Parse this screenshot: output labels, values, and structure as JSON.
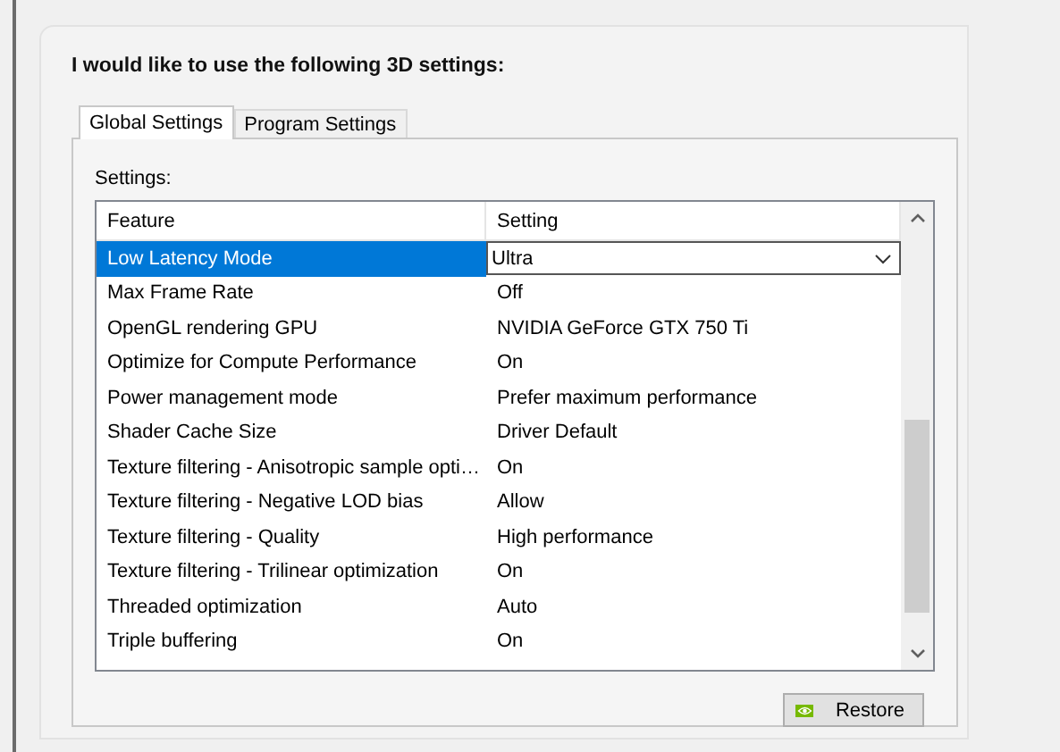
{
  "heading": "I would like to use the following 3D settings:",
  "tabs": [
    {
      "label": "Global Settings",
      "selected": true
    },
    {
      "label": "Program Settings",
      "selected": false
    }
  ],
  "settings_label": "Settings:",
  "table": {
    "columns": [
      "Feature",
      "Setting"
    ],
    "rows": [
      {
        "feature": "Low Latency Mode",
        "setting": "Ultra",
        "selected": true
      },
      {
        "feature": "Max Frame Rate",
        "setting": "Off",
        "selected": false
      },
      {
        "feature": "OpenGL rendering GPU",
        "setting": "NVIDIA GeForce GTX 750 Ti",
        "selected": false
      },
      {
        "feature": "Optimize for Compute Performance",
        "setting": "On",
        "selected": false
      },
      {
        "feature": "Power management mode",
        "setting": "Prefer maximum performance",
        "selected": false
      },
      {
        "feature": "Shader Cache Size",
        "setting": "Driver Default",
        "selected": false
      },
      {
        "feature": "Texture filtering - Anisotropic sample opti…",
        "setting": "On",
        "selected": false
      },
      {
        "feature": "Texture filtering - Negative LOD bias",
        "setting": "Allow",
        "selected": false
      },
      {
        "feature": "Texture filtering - Quality",
        "setting": "High performance",
        "selected": false
      },
      {
        "feature": "Texture filtering - Trilinear optimization",
        "setting": "On",
        "selected": false
      },
      {
        "feature": "Threaded optimization",
        "setting": "Auto",
        "selected": false
      },
      {
        "feature": "Triple buffering",
        "setting": "On",
        "selected": false
      }
    ]
  },
  "restore_button": "Restore"
}
